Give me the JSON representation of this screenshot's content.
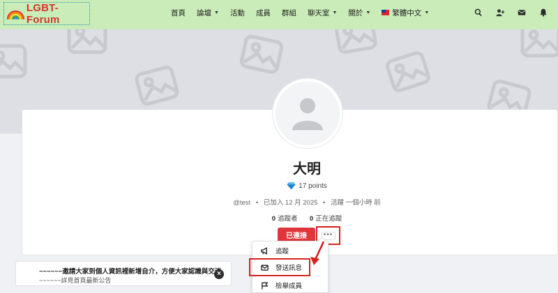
{
  "brand": {
    "name": "LGBT-Forum"
  },
  "nav": {
    "items": [
      {
        "label": "首頁",
        "has_dropdown": false
      },
      {
        "label": "論壇",
        "has_dropdown": true
      },
      {
        "label": "活動",
        "has_dropdown": false
      },
      {
        "label": "成員",
        "has_dropdown": false
      },
      {
        "label": "群組",
        "has_dropdown": false
      },
      {
        "label": "聊天室",
        "has_dropdown": true
      },
      {
        "label": "關於",
        "has_dropdown": true
      },
      {
        "label": "繁體中文",
        "has_dropdown": true
      }
    ],
    "icons": [
      "search-icon",
      "add-user-icon",
      "envelope-icon",
      "bell-icon"
    ]
  },
  "profile": {
    "display_name": "大明",
    "points": "17 points",
    "handle": "@test",
    "joined": "已加入 12 月 2025",
    "active": "活躍 一個小時 前",
    "followers_count": "0",
    "followers_label": "追蹤者",
    "following_count": "0",
    "following_label": "正在追蹤",
    "connected_button": "已連接",
    "more_button": "•••"
  },
  "dropdown": {
    "items": [
      {
        "label": "追蹤",
        "icon": "megaphone-icon"
      },
      {
        "label": "發送訊息",
        "icon": "envelope-icon"
      },
      {
        "label": "檢舉成員",
        "icon": "flag-icon"
      }
    ]
  },
  "announcement": {
    "line1": "~~~~~~邀請大家到個人資訊裡新增自介，方便大家認識與交流",
    "line2": "~~~~~~詳見首頁最新公告",
    "close": "×"
  },
  "colors": {
    "nav_bg": "#c9ecb8",
    "brand_red": "#d2362b",
    "button_red": "#e0363b",
    "highlight": "#d42020"
  }
}
